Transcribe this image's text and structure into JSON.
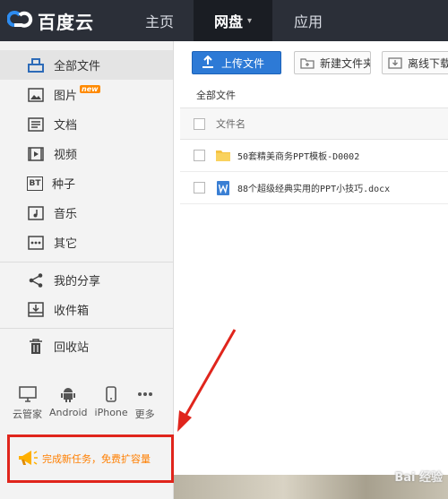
{
  "brand": {
    "name": "百度云"
  },
  "nav": {
    "home": "主页",
    "disk": "网盘",
    "app": "应用"
  },
  "sidebar": {
    "items": [
      {
        "label": "全部文件",
        "icon": "folder-tray-icon",
        "active": true
      },
      {
        "label": "图片",
        "icon": "image-icon",
        "badge": "new"
      },
      {
        "label": "文档",
        "icon": "document-icon"
      },
      {
        "label": "视频",
        "icon": "video-icon"
      },
      {
        "label": "种子",
        "icon": "bt-icon",
        "glyph": "BT"
      },
      {
        "label": "音乐",
        "icon": "music-icon"
      },
      {
        "label": "其它",
        "icon": "more-dots-icon"
      }
    ],
    "share": {
      "label": "我的分享",
      "icon": "share-icon"
    },
    "inbox": {
      "label": "收件箱",
      "icon": "inbox-icon"
    },
    "trash": {
      "label": "回收站",
      "icon": "trash-icon"
    },
    "clients": [
      {
        "label": "云管家",
        "icon": "monitor-icon"
      },
      {
        "label": "Android",
        "icon": "android-icon"
      },
      {
        "label": "iPhone",
        "icon": "iphone-icon"
      },
      {
        "label": "更多",
        "icon": "more-icon"
      }
    ],
    "promo": {
      "label": "完成新任务，免费扩容量",
      "icon": "megaphone-icon"
    }
  },
  "toolbar": {
    "upload": "上传文件",
    "new_folder": "新建文件夹",
    "offline": "离线下载"
  },
  "breadcrumb": "全部文件",
  "file_list": {
    "header": "文件名",
    "rows": [
      {
        "name": "50套精美商务PPT模板-D0002",
        "type": "folder"
      },
      {
        "name": "88个超级经典实用的PPT小技巧.docx",
        "type": "word"
      }
    ]
  },
  "watermark": "Bai 经验",
  "colors": {
    "nav_bg": "#2b2f38",
    "accent": "#2d7ad6",
    "promo_border": "#e0251c",
    "promo_text": "#ff7f00",
    "folder": "#f5c342",
    "word": "#3a7fd4"
  }
}
